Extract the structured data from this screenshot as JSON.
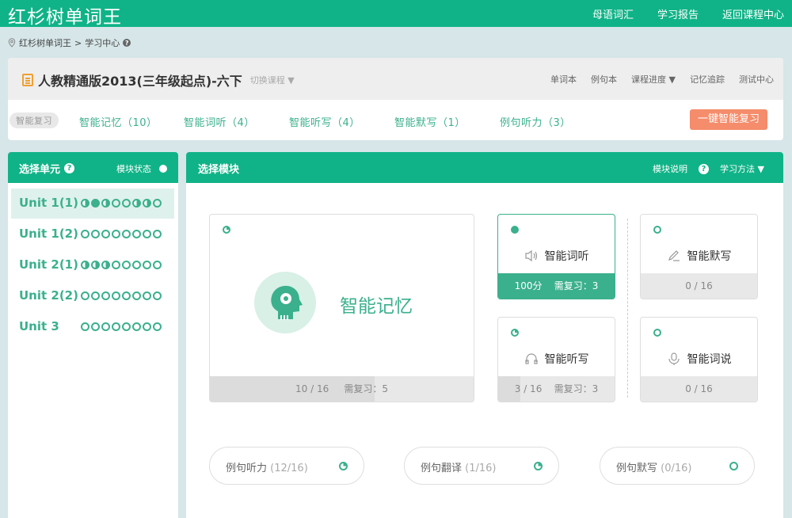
{
  "app": {
    "title": "红杉树单词王"
  },
  "topnav": [
    "母语词汇",
    "学习报告",
    "返回课程中心"
  ],
  "breadcrumb": {
    "home": "红杉树单词王",
    "sep": ">",
    "current": "学习中心"
  },
  "course": {
    "title": "人教精通版2013(三年级起点)-六下",
    "switch_label": "切换课程 ▼"
  },
  "header_links": [
    "单词本",
    "例句本",
    "课程进度 ▼",
    "记忆追踪",
    "测试中心"
  ],
  "tabs": [
    "智能复习",
    "智能记忆（10）",
    "智能词听（4）",
    "智能听写（4）",
    "智能默写（1）",
    "例句听力（3）"
  ],
  "review_button": "一键智能复习",
  "left_panel": {
    "title": "选择单元",
    "state_label": "模块状态"
  },
  "units": [
    {
      "name": "Unit 1(1)",
      "dots": [
        "half",
        "full",
        "half",
        "empty",
        "empty",
        "half",
        "half",
        "empty"
      ]
    },
    {
      "name": "Unit 1(2)",
      "dots": [
        "empty",
        "empty",
        "empty",
        "empty",
        "empty",
        "empty",
        "empty",
        "empty"
      ]
    },
    {
      "name": "Unit 2(1)",
      "dots": [
        "half",
        "half",
        "half",
        "empty",
        "empty",
        "empty",
        "empty",
        "empty"
      ]
    },
    {
      "name": "Unit 2(2)",
      "dots": [
        "empty",
        "empty",
        "empty",
        "empty",
        "empty",
        "empty",
        "empty",
        "empty"
      ]
    },
    {
      "name": "Unit 3",
      "dots": [
        "empty",
        "empty",
        "empty",
        "empty",
        "empty",
        "empty",
        "empty",
        "empty"
      ]
    }
  ],
  "main_panel": {
    "title": "选择模块",
    "explain": "模块说明",
    "method": "学习方法 ▼"
  },
  "modules": {
    "memory": {
      "label": "智能记忆",
      "progress": "10 / 16",
      "review": "需复习：5",
      "fraction": 0.625
    },
    "listen_word": {
      "label": "智能词听",
      "score": "100分",
      "review": "需复习：3"
    },
    "dictate_silent": {
      "label": "智能默写",
      "progress": "0 / 16"
    },
    "dictation": {
      "label": "智能听写",
      "progress": "3 / 16",
      "review": "需复习：3",
      "fraction": 0.19
    },
    "speak": {
      "label": "智能词说",
      "progress": "0 / 16"
    }
  },
  "sentence_modules": [
    {
      "label": "例句听力",
      "count": "(12/16)"
    },
    {
      "label": "例句翻译",
      "count": "(1/16)"
    },
    {
      "label": "例句默写",
      "count": "(0/16)"
    }
  ],
  "colors": {
    "brand": "#10b387",
    "accent": "#3bb08c",
    "button": "#f58c6b"
  }
}
